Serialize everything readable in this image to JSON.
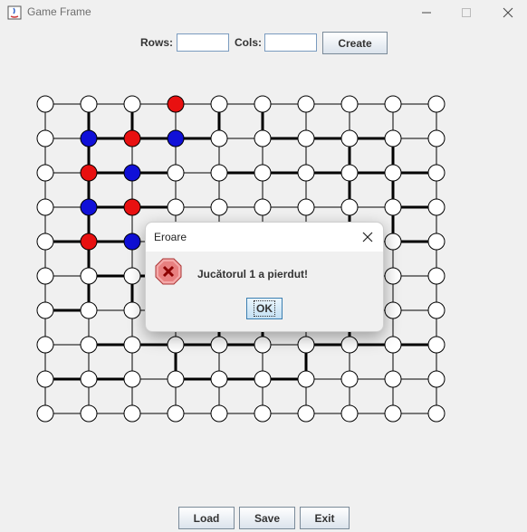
{
  "window": {
    "title": "Game Frame"
  },
  "toolbar": {
    "rows_label": "Rows:",
    "rows_value": "",
    "cols_label": "Cols:",
    "cols_value": "",
    "create_label": "Create"
  },
  "board": {
    "rows": 10,
    "cols": 10,
    "line_color": "#000000",
    "stone_colors": {
      "red": "#e81010",
      "blue": "#1010d8",
      "empty": "#ffffff"
    },
    "stones": [
      {
        "row": 0,
        "col": 3,
        "color": "red"
      },
      {
        "row": 1,
        "col": 1,
        "color": "blue"
      },
      {
        "row": 1,
        "col": 2,
        "color": "red"
      },
      {
        "row": 1,
        "col": 3,
        "color": "blue"
      },
      {
        "row": 2,
        "col": 1,
        "color": "red"
      },
      {
        "row": 2,
        "col": 2,
        "color": "blue"
      },
      {
        "row": 3,
        "col": 1,
        "color": "blue"
      },
      {
        "row": 3,
        "col": 2,
        "color": "red"
      },
      {
        "row": 4,
        "col": 1,
        "color": "red"
      },
      {
        "row": 4,
        "col": 2,
        "color": "blue"
      }
    ]
  },
  "dialog": {
    "title": "Eroare",
    "message": "Jucătorul 1 a pierdut!",
    "ok_label": "OK",
    "icon": "error-icon"
  },
  "footer": {
    "load_label": "Load",
    "save_label": "Save",
    "exit_label": "Exit"
  }
}
